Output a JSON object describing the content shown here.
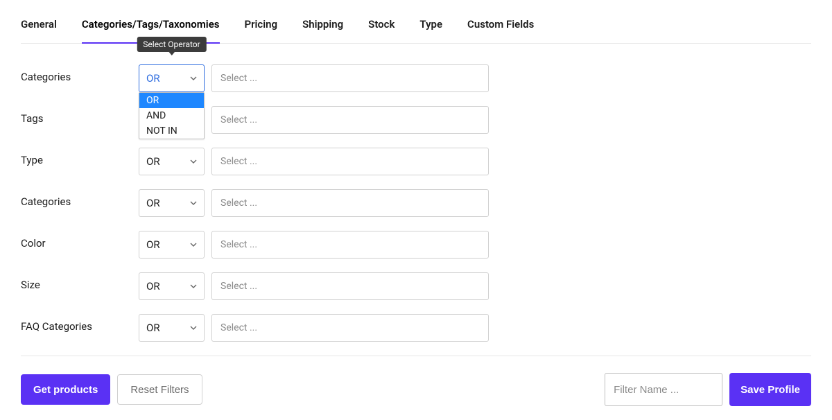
{
  "tabs": [
    {
      "label": "General",
      "active": false
    },
    {
      "label": "Categories/Tags/Taxonomies",
      "active": true
    },
    {
      "label": "Pricing",
      "active": false
    },
    {
      "label": "Shipping",
      "active": false
    },
    {
      "label": "Stock",
      "active": false
    },
    {
      "label": "Type",
      "active": false
    },
    {
      "label": "Custom Fields",
      "active": false
    }
  ],
  "tooltip": "Select Operator",
  "operator_options": [
    "OR",
    "AND",
    "NOT IN"
  ],
  "rows": [
    {
      "label": "Categories",
      "operator": "OR",
      "placeholder": "Select ...",
      "open": true
    },
    {
      "label": "Tags",
      "operator": "OR",
      "placeholder": "Select ...",
      "open": false
    },
    {
      "label": "Type",
      "operator": "OR",
      "placeholder": "Select ...",
      "open": false
    },
    {
      "label": "Categories",
      "operator": "OR",
      "placeholder": "Select ...",
      "open": false
    },
    {
      "label": "Color",
      "operator": "OR",
      "placeholder": "Select ...",
      "open": false
    },
    {
      "label": "Size",
      "operator": "OR",
      "placeholder": "Select ...",
      "open": false
    },
    {
      "label": "FAQ Categories",
      "operator": "OR",
      "placeholder": "Select ...",
      "open": false
    }
  ],
  "buttons": {
    "get_products": "Get products",
    "reset_filters": "Reset Filters",
    "save_profile": "Save Profile"
  },
  "filter_name_placeholder": "Filter Name ...",
  "colors": {
    "accent": "#5a31f4",
    "dropdown_sel": "#1e87ff"
  }
}
